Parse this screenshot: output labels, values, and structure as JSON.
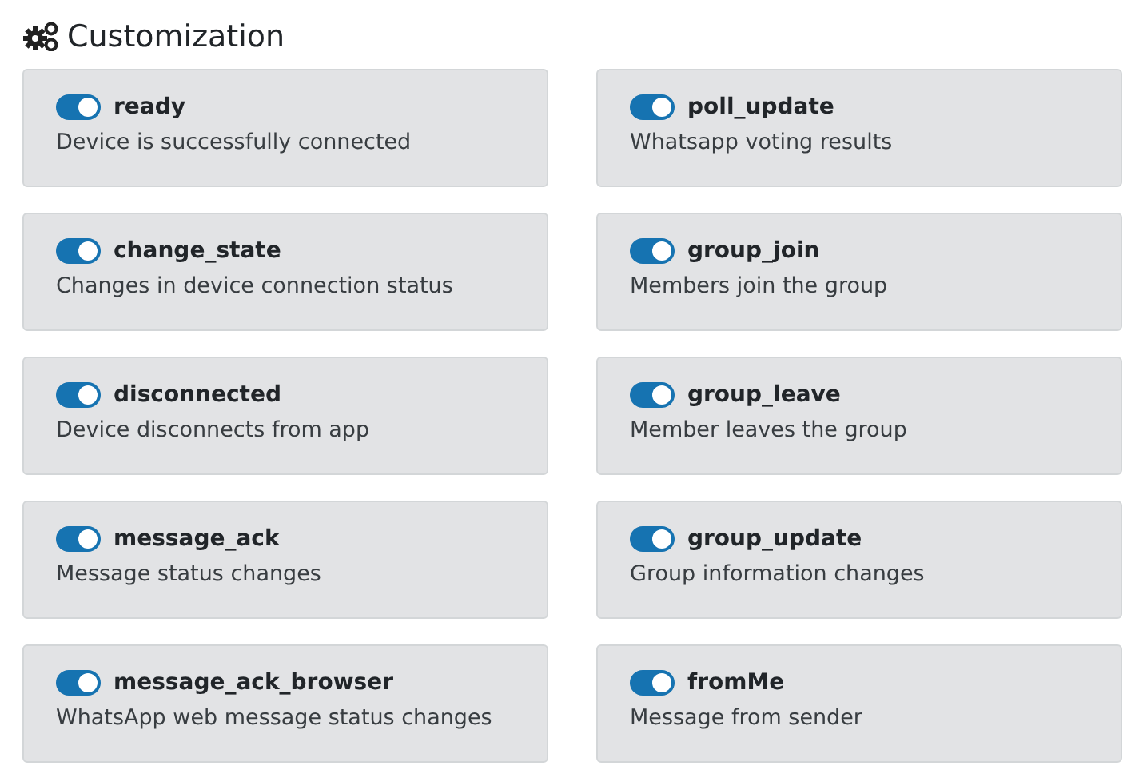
{
  "title": "Customization",
  "events": [
    {
      "name": "ready",
      "description": "Device is successfully connected",
      "on": true
    },
    {
      "name": "poll_update",
      "description": "Whatsapp voting results",
      "on": true
    },
    {
      "name": "change_state",
      "description": "Changes in device connection status",
      "on": true
    },
    {
      "name": "group_join",
      "description": "Members join the group",
      "on": true
    },
    {
      "name": "disconnected",
      "description": "Device disconnects from app",
      "on": true
    },
    {
      "name": "group_leave",
      "description": "Member leaves the group",
      "on": true
    },
    {
      "name": "message_ack",
      "description": "Message status changes",
      "on": true
    },
    {
      "name": "group_update",
      "description": "Group information changes",
      "on": true
    },
    {
      "name": "message_ack_browser",
      "description": "WhatsApp web message status changes",
      "on": true
    },
    {
      "name": "fromMe",
      "description": "Message from sender",
      "on": true
    }
  ]
}
